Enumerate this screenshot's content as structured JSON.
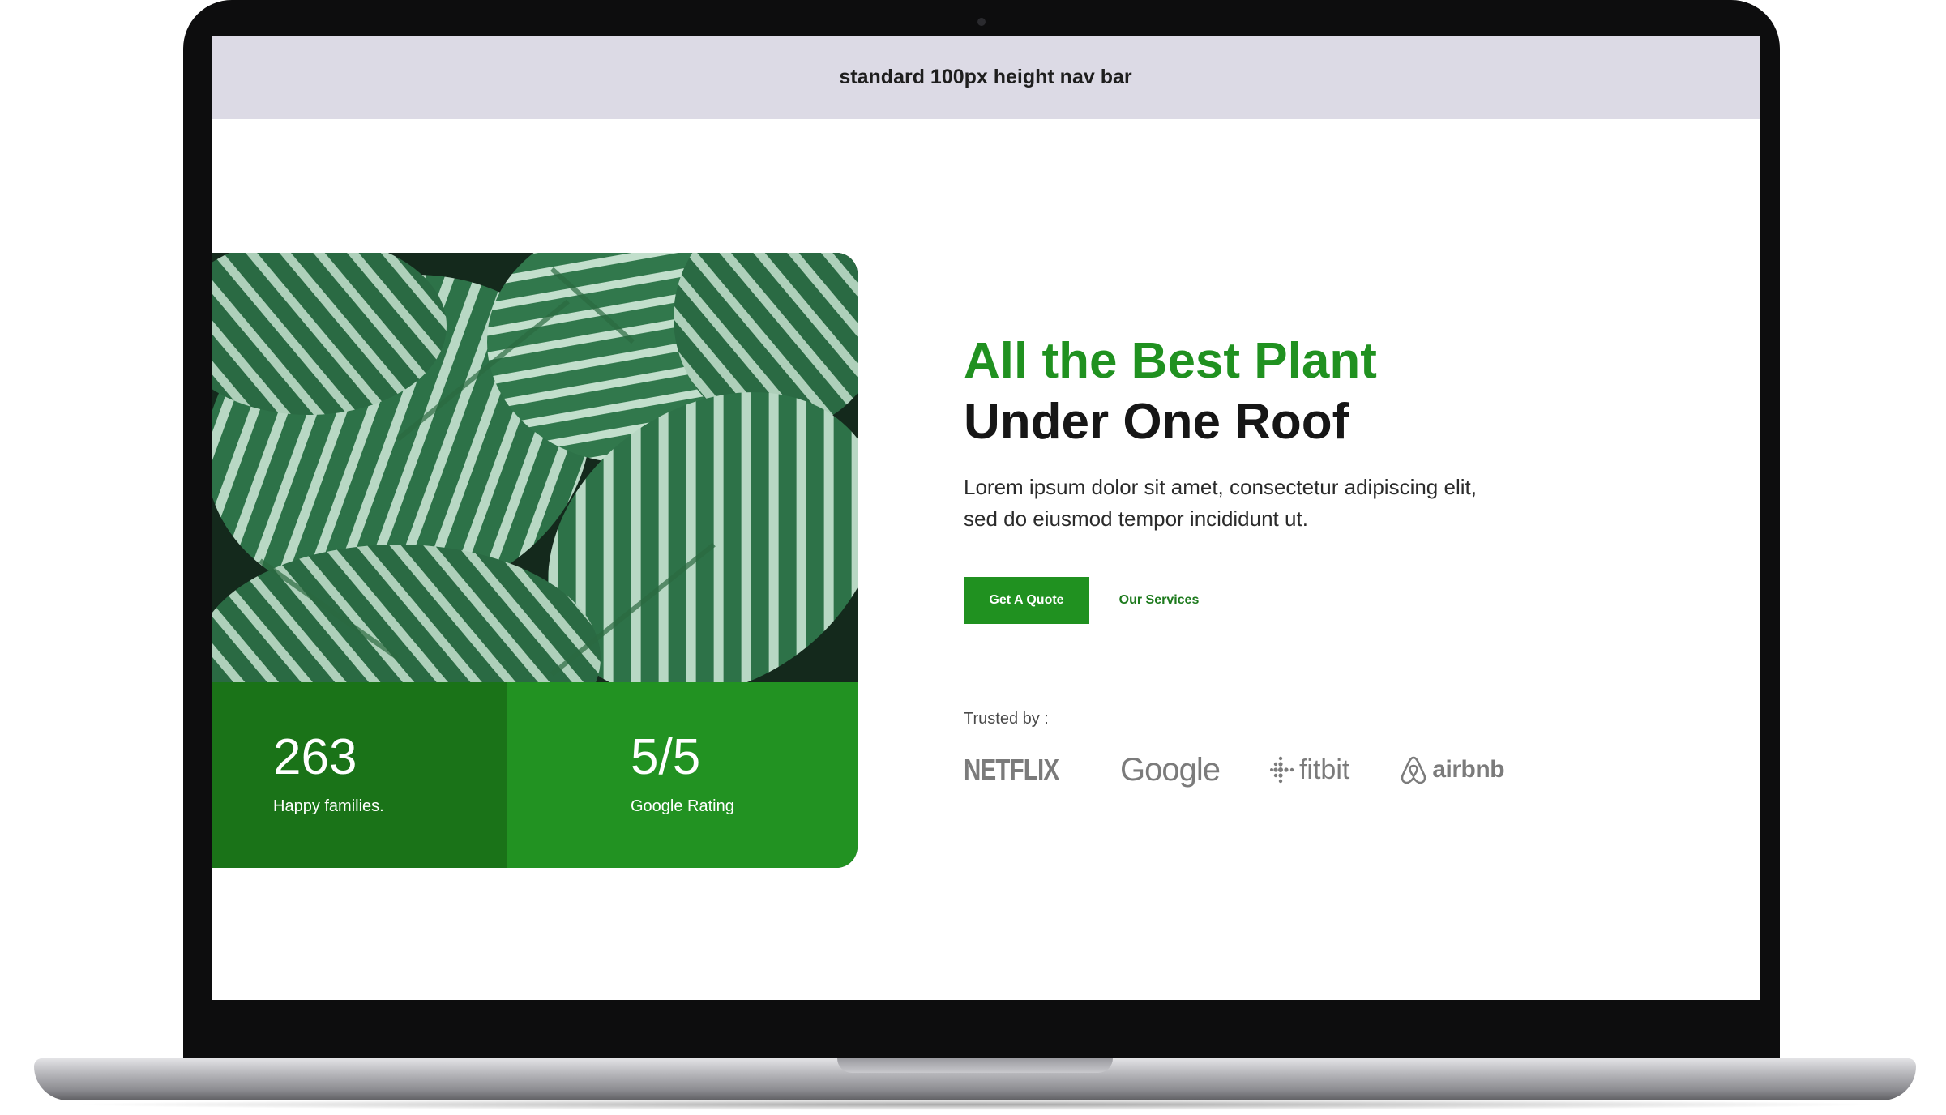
{
  "nav": {
    "title": "standard 100px height nav bar"
  },
  "hero": {
    "headline_green": "All the Best Plant",
    "headline_dark": "Under One Roof",
    "description_line1": "Lorem ipsum dolor sit amet, consectetur adipiscing elit,",
    "description_line2": "sed do eiusmod tempor incididunt ut.",
    "primary_button": "Get A Quote",
    "secondary_button": "Our Services",
    "trusted_label": "Trusted by :"
  },
  "stats": [
    {
      "value": "263",
      "label": "Happy families."
    },
    {
      "value": "5/5",
      "label": "Google Rating"
    }
  ],
  "logos": {
    "netflix": "NETFLIX",
    "google": "Google",
    "fitbit": "fitbit",
    "airbnb": "airbnb"
  },
  "colors": {
    "brand_green": "#209120",
    "dark_green": "#1a7318",
    "nav_bg": "#dcdae5",
    "logo_gray": "#7b7b7b"
  },
  "icons": [
    "leaf-photo",
    "fitbit-dots-icon",
    "airbnb-belo-icon"
  ]
}
